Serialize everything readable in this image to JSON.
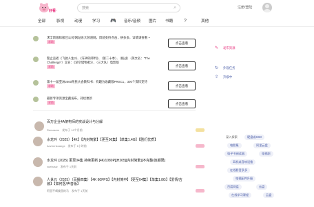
{
  "header": {
    "logo_text": "好看·",
    "search_placeholder": "搜索",
    "login_text": "注册/登陆"
  },
  "nav": {
    "items": [
      {
        "label": "全部",
        "active": false
      },
      {
        "label": "影视",
        "active": false
      },
      {
        "label": "动漫",
        "active": false
      },
      {
        "label": "学习",
        "active": false
      },
      {
        "label": "",
        "active": true
      },
      {
        "label": "音乐/音频",
        "active": false
      },
      {
        "label": "图片",
        "active": false
      },
      {
        "label": "书籍",
        "active": false
      },
      {
        "label": "",
        "active": false
      },
      {
        "label": "其他",
        "active": false
      }
    ]
  },
  "panel": {
    "rows": [
      {
        "text": "求全新咖啡极佳公司/网站东大频道网，目前支持点击，拼多多，详情请查看 ~",
        "tag": "求助",
        "button": "点击查看"
      },
      {
        "text": "警止竞者《飞驰人生2》、《车神的审判》、（第二十季）、（挑战）（英文名：\"The Challenge\"）又名：《深空猎物者》）、（三大队）电影版",
        "tag": "求助",
        "button": "点击查看"
      },
      {
        "text": "第十一届亚洲2000附民大会教科书：有趣为收藏版PRSC1，300个资料支持",
        "tag": "求助",
        "button": "点击查看"
      },
      {
        "text": "最新专项资源宝藏发布，持续更新",
        "tag": "求助",
        "button": "点击查看"
      }
    ]
  },
  "right_top": {
    "items": [
      {
        "label": "发布资源",
        "icon": "edit-icon"
      },
      {
        "label": "外观任务",
        "icon": "task-icon"
      },
      {
        "label": "升级中",
        "icon": "upgrade-icon"
      }
    ]
  },
  "list": {
    "items": [
      {
        "title": "百万企业4A架构师的实战设计与分解",
        "meta_user": "Remasem",
        "meta_time": "发布于 10个月前",
        "pill": "yellow"
      },
      {
        "title": "水龙吟（2025）【4K】【内封简繁】【更至06集】【单集1.4G】【剧们优质】",
        "meta_user": "Anzhenkoangx",
        "meta_time": "发布于 1小时前",
        "pill": "pink"
      },
      {
        "title": "水龙吟 (2025) 更至04集 持续更新 [4K/1080P][H265][内封简繁][不完整/连期限]",
        "meta_user": "xuebusiz",
        "meta_time": "发布于 1天前",
        "pill": "pink"
      },
      {
        "title": "人世元（2025）（百播四集）【4K 60FPS】【内封简中】【更至04集】【单集1.8G】【爱情/古装】【如何医/声音版】",
        "meta_user": "阿里不喝美国的马",
        "meta_time": "发布于 1天前",
        "pill": "pink"
      }
    ]
  },
  "tags": {
    "chips": [
      {
        "label": "深入探索",
        "plain": true
      },
      {
        "label": "硬盘或SSD"
      },
      {
        "label": "电影集"
      },
      {
        "label": "阿里云盘"
      },
      {
        "label": "电子书阅读器"
      },
      {
        "label": "电视剧"
      },
      {
        "label": "耳机或音响设备"
      },
      {
        "label": "在线影音多多"
      },
      {
        "label": "电视配件升级"
      },
      {
        "label": "百度网盘"
      },
      {
        "label": "云盘"
      },
      {
        "label": "在线学习课程"
      },
      {
        "label": "云盘"
      }
    ]
  },
  "colors": {
    "accent": "#e8337e",
    "chip_text": "#4a5da8",
    "chip_bg": "#eef0f8"
  }
}
